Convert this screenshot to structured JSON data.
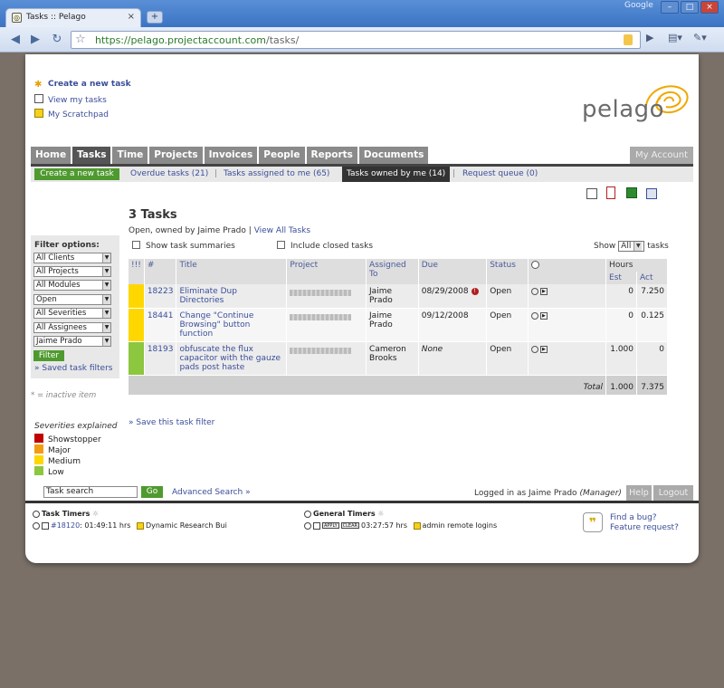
{
  "browser": {
    "tab_title": "Tasks :: Pelago",
    "google_label": "Google",
    "url_scheme": "https://",
    "url_host": "pelago.projectaccount.com",
    "url_path": "/tasks/"
  },
  "header": {
    "links": [
      "Create a new task",
      "View my tasks",
      "My Scratchpad"
    ],
    "logo_text": "pelago"
  },
  "main_nav": {
    "items": [
      "Home",
      "Tasks",
      "Time",
      "Projects",
      "Invoices",
      "People",
      "Reports",
      "Documents"
    ],
    "active": "Tasks",
    "my_account": "My Account"
  },
  "sub_nav": {
    "create_button": "Create a new task",
    "items": [
      "Overdue tasks (21)",
      "Tasks assigned to me (65)",
      "Tasks owned by me (14)",
      "Request queue (0)"
    ],
    "separator": "|",
    "active_index": 2
  },
  "content": {
    "heading": "3 Tasks",
    "subheading_prefix": "Open, owned by Jaime Prado",
    "subheading_sep": "|",
    "view_all": "View All Tasks",
    "show_summaries": "Show task summaries",
    "include_closed": "Include closed tasks",
    "show_label": "Show",
    "show_value": "All",
    "show_suffix": "tasks"
  },
  "filter": {
    "label": "Filter options:",
    "selects": [
      "All Clients",
      "All Projects",
      "All Modules",
      "Open",
      "All Severities",
      "All Assignees",
      "Jaime Prado"
    ],
    "button": "Filter",
    "saved": "» Saved task filters",
    "inactive_note": "* = inactive item"
  },
  "severities": {
    "title": "Severities explained",
    "items": [
      {
        "label": "Showstopper",
        "color": "#c00000"
      },
      {
        "label": "Major",
        "color": "#f39c12"
      },
      {
        "label": "Medium",
        "color": "#ffd700"
      },
      {
        "label": "Low",
        "color": "#8dc63f"
      }
    ]
  },
  "table": {
    "headers": {
      "sev": "!!!",
      "num": "#",
      "title": "Title",
      "project": "Project",
      "assigned": "Assigned To",
      "due": "Due",
      "status": "Status",
      "hours": "Hours",
      "est": "Est",
      "act": "Act"
    },
    "rows": [
      {
        "sev_color": "#ffd700",
        "id": "18223",
        "title": "Eliminate Dup Directories",
        "assigned": "Jaime Prado",
        "due": "08/29/2008",
        "overdue": true,
        "status": "Open",
        "est": "0",
        "act": "7.250"
      },
      {
        "sev_color": "#ffd700",
        "id": "18441",
        "title": "Change \"Continue Browsing\" button function",
        "assigned": "Jaime Prado",
        "due": "09/12/2008",
        "overdue": false,
        "status": "Open",
        "est": "0",
        "act": "0.125"
      },
      {
        "sev_color": "#8dc63f",
        "id": "18193",
        "title": "obfuscate the flux capacitor with the gauze pads post haste",
        "assigned": "Cameron Brooks",
        "due": "None",
        "overdue": false,
        "status": "Open",
        "est": "1.000",
        "act": "0"
      }
    ],
    "total_label": "Total",
    "total_est": "1.000",
    "total_act": "7.375"
  },
  "save_filter": "» Save this task filter",
  "bottom": {
    "search_value": "Task search",
    "go": "Go",
    "advanced": "Advanced Search »",
    "logged_in_prefix": "Logged in as Jaime Prado",
    "logged_in_role": "(Manager)",
    "help": "Help",
    "logout": "Logout"
  },
  "timers": {
    "task_title": "Task Timers",
    "task_id": "#18120",
    "task_time": ": 01:49:11 hrs",
    "task_name": "Dynamic Research Bui",
    "general_title": "General Timers",
    "apply": "APPLY",
    "clear": "CLEAR",
    "general_time": "03:27:57 hrs",
    "general_name": "admin remote logins"
  },
  "bug": {
    "icon_text": "❞",
    "line1": "Find a bug?",
    "line2": "Feature request?"
  }
}
